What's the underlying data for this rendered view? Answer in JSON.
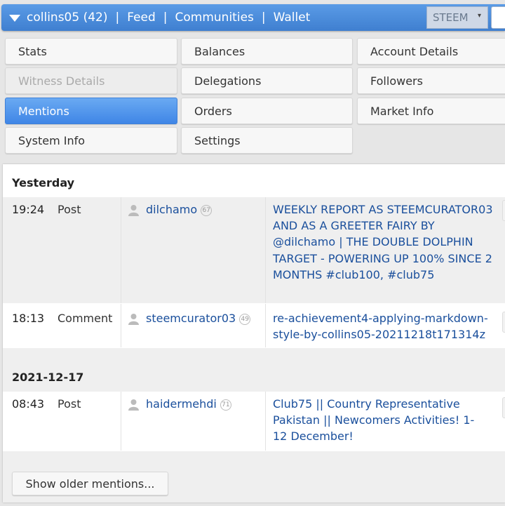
{
  "header": {
    "account": "collins05 (42)",
    "feed": "Feed",
    "communities": "Communities",
    "wallet": "Wallet",
    "separator": "|",
    "chain_select": "STEEM",
    "chain_arrow": "▾"
  },
  "menu": [
    {
      "label": "Stats",
      "state": "normal"
    },
    {
      "label": "Balances",
      "state": "normal"
    },
    {
      "label": "Account Details",
      "state": "normal"
    },
    {
      "label": "Witness Details",
      "state": "disabled"
    },
    {
      "label": "Delegations",
      "state": "normal"
    },
    {
      "label": "Followers",
      "state": "normal"
    },
    {
      "label": "Mentions",
      "state": "active"
    },
    {
      "label": "Orders",
      "state": "normal"
    },
    {
      "label": "Market Info",
      "state": "normal"
    },
    {
      "label": "System Info",
      "state": "normal"
    },
    {
      "label": "Settings",
      "state": "normal"
    }
  ],
  "mentions": {
    "groups": [
      {
        "date": "Yesterday",
        "items": [
          {
            "time": "19:24",
            "type": "Post",
            "user": "dilchamo",
            "rep": "67",
            "title": "WEEKLY REPORT AS STEEMCURATOR03 AND AS A GREETER FAIRY BY @dilchamo | THE DOUBLE DOLPHIN TARGET - POWERING UP 100% SINCE 2 MONTHS #club100, #club75"
          },
          {
            "time": "18:13",
            "type": "Comment",
            "user": "steemcurator03",
            "rep": "49",
            "title": "re-achievement4-applying-markdown-style-by-collins05-20211218t171314z"
          }
        ]
      },
      {
        "date": "2021-12-17",
        "items": [
          {
            "time": "08:43",
            "type": "Post",
            "user": "haidermehdi",
            "rep": "71",
            "title": "Club75 || Country Representative Pakistan || Newcomers Activities! 1-12 December!"
          }
        ]
      }
    ],
    "older_label": "Show older mentions..."
  },
  "colors": {
    "accent": "#3f7fd0",
    "link": "#1a4f9c",
    "active_tab": "#4a8fe8"
  }
}
